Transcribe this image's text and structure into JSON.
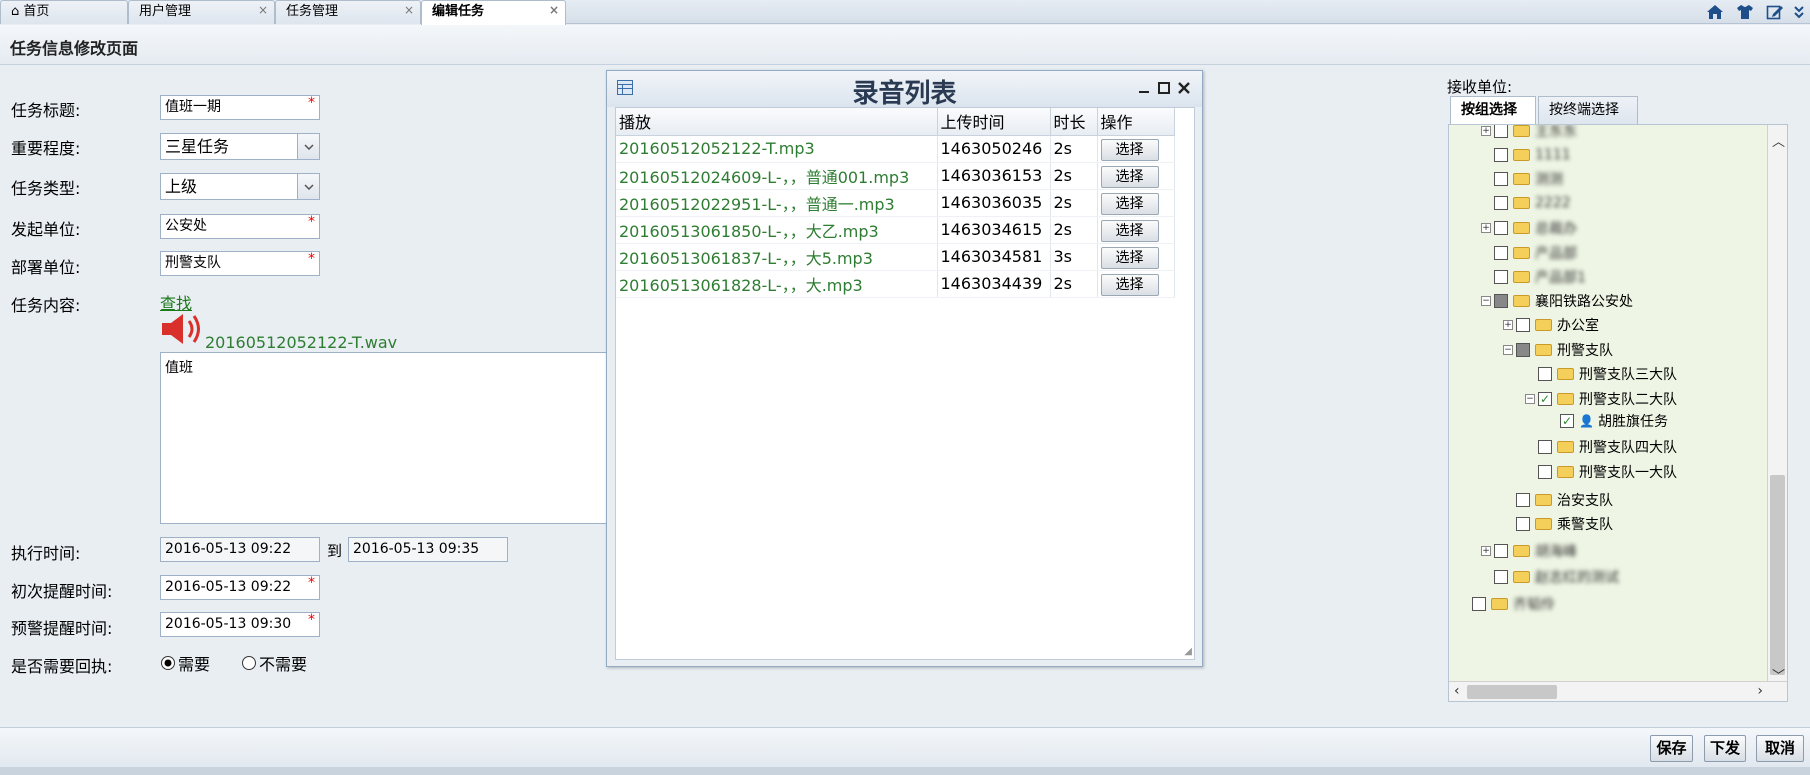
{
  "tabs": [
    {
      "label": "首页",
      "icon": "home-icon"
    },
    {
      "label": "用户管理"
    },
    {
      "label": "任务管理"
    },
    {
      "label": "编辑任务"
    }
  ],
  "page_title": "任务信息修改页面",
  "form": {
    "title_label": "任务标题:",
    "title_value": "值班一期",
    "importance_label": "重要程度:",
    "importance_value": "三星任务",
    "type_label": "任务类型:",
    "type_value": "上级",
    "origin_label": "发起单位:",
    "origin_value": "公安处",
    "deploy_label": "部署单位:",
    "deploy_value": "刑警支队",
    "content_label": "任务内容:",
    "find_link": "查找",
    "audio_file": "20160512052122-T.wav",
    "content_text": "值班",
    "exec_label": "执行时间:",
    "exec_start": "2016-05-13 09:22",
    "exec_to": "到",
    "exec_end": "2016-05-13 09:35",
    "first_remind_label": "初次提醒时间:",
    "first_remind_value": "2016-05-13 09:22",
    "warn_remind_label": "预警提醒时间:",
    "warn_remind_value": "2016-05-13 09:30",
    "reply_label": "是否需要回执:",
    "reply_yes": "需要",
    "reply_no": "不需要",
    "reply_selected": "需要"
  },
  "dialog": {
    "title": "录音列表",
    "columns": [
      "播放",
      "上传时间",
      "时长",
      "操作"
    ],
    "rows": [
      {
        "file": "20160512052122-T.mp3",
        "time": "1463050246",
        "dur": "2s",
        "action": "选择"
      },
      {
        "file": "20160512024609-L-，，普通001.mp3",
        "time": "1463036153",
        "dur": "2s",
        "action": "选择"
      },
      {
        "file": "20160512022951-L-，，普通一.mp3",
        "time": "1463036035",
        "dur": "2s",
        "action": "选择"
      },
      {
        "file": "20160513061850-L-，，大乙.mp3",
        "time": "1463034615",
        "dur": "2s",
        "action": "选择"
      },
      {
        "file": "20160513061837-L-，，大5.mp3",
        "time": "1463034581",
        "dur": "3s",
        "action": "选择"
      },
      {
        "file": "20160513061828-L-，，大.mp3",
        "time": "1463034439",
        "dur": "2s",
        "action": "选择"
      }
    ]
  },
  "receiver": {
    "label": "接收单位:",
    "tabs": [
      "按组选择",
      "按终端选择"
    ],
    "tree": [
      {
        "label": "王东东",
        "expander": "+",
        "check": "none",
        "blurred": true
      },
      {
        "label": "1111",
        "expander": "",
        "check": "none",
        "blurred": true
      },
      {
        "label": "测测",
        "expander": "",
        "check": "none",
        "blurred": true
      },
      {
        "label": "2222",
        "expander": "",
        "check": "none",
        "blurred": true
      },
      {
        "label": "总裁办",
        "expander": "+",
        "check": "none",
        "blurred": true
      },
      {
        "label": "产品部",
        "expander": "",
        "check": "none",
        "blurred": true
      },
      {
        "label": "产品部1",
        "expander": "",
        "check": "none",
        "blurred": true
      },
      {
        "label": "襄阳铁路公安处",
        "expander": "−",
        "check": "partial",
        "blurred": false
      },
      {
        "label": "办公室",
        "expander": "+",
        "check": "none",
        "blurred": false
      },
      {
        "label": "刑警支队",
        "expander": "−",
        "check": "partial",
        "blurred": false
      },
      {
        "label": "刑警支队三大队",
        "expander": "",
        "check": "none",
        "blurred": false
      },
      {
        "label": "刑警支队二大队",
        "expander": "−",
        "check": "checked",
        "blurred": false
      },
      {
        "label": "胡胜旗任务",
        "expander": "",
        "check": "checked",
        "blurred": false,
        "user": true
      },
      {
        "label": "刑警支队四大队",
        "expander": "",
        "check": "none",
        "blurred": false
      },
      {
        "label": "刑警支队一大队",
        "expander": "",
        "check": "none",
        "blurred": false
      },
      {
        "label": "治安支队",
        "expander": "",
        "check": "none",
        "blurred": false
      },
      {
        "label": "乘警支队",
        "expander": "",
        "check": "none",
        "blurred": false
      },
      {
        "label": "胡海峰",
        "expander": "+",
        "check": "none",
        "blurred": true
      },
      {
        "label": "赵志红的测试",
        "expander": "",
        "check": "none",
        "blurred": true
      },
      {
        "label": "齐韬伶",
        "expander": "",
        "check": "none",
        "blurred": true
      }
    ]
  },
  "buttons": {
    "save": "保存",
    "issue": "下发",
    "cancel": "取消"
  }
}
